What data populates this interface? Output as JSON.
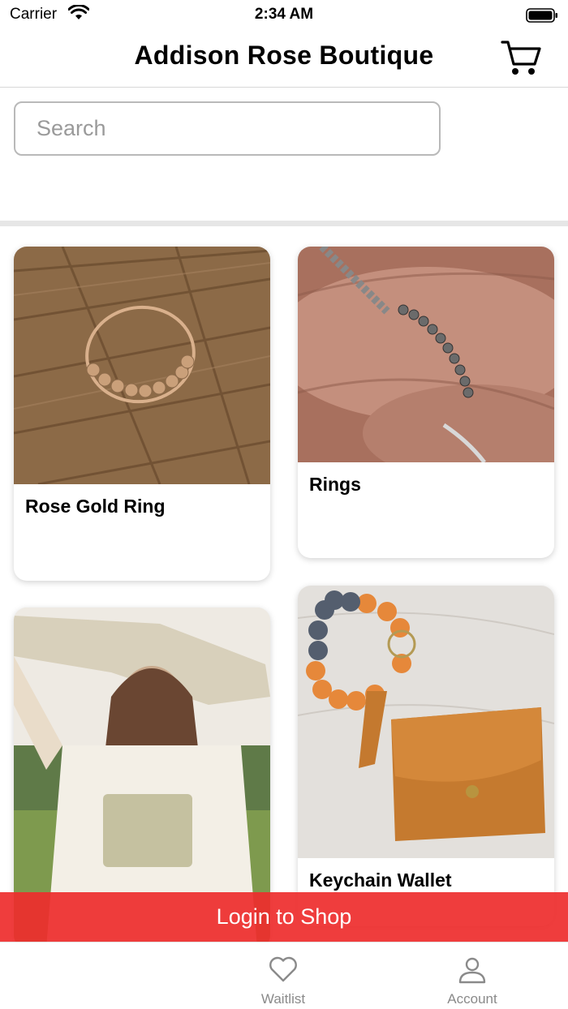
{
  "status_bar": {
    "carrier": "Carrier",
    "time": "2:34 AM"
  },
  "header": {
    "title": "Addison Rose Boutique",
    "cart_icon": "cart-icon"
  },
  "search": {
    "placeholder": "Search",
    "value": ""
  },
  "products": [
    {
      "title": "Rose Gold Ring",
      "image": "rose-gold-ring-photo"
    },
    {
      "title": "Rings",
      "image": "beaded-rings-photo"
    },
    {
      "title": "",
      "image": "woman-graphic-tee-photo"
    },
    {
      "title": "Keychain Wallet",
      "image": "keychain-wallet-photo"
    }
  ],
  "banner": {
    "label": "Login to Shop"
  },
  "tabs": [
    {
      "label": "Waitlist",
      "icon": "heart-icon"
    },
    {
      "label": "Account",
      "icon": "person-icon"
    }
  ],
  "colors": {
    "banner": "#EE2C2C",
    "tab_label": "#8A8A8A",
    "border": "#B9B9B9"
  }
}
